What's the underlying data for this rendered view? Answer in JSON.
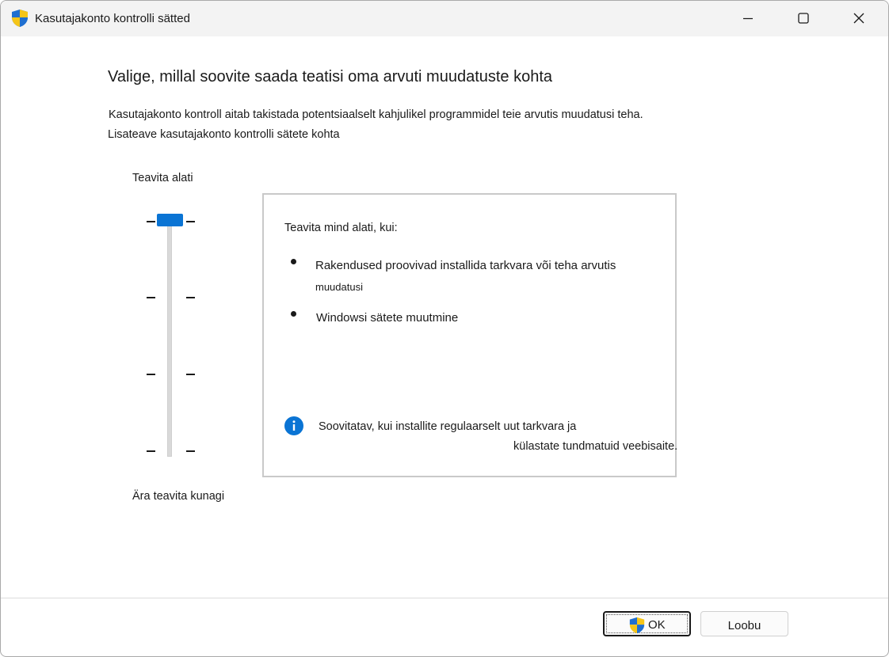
{
  "window": {
    "title": "Kasutajakonto kontrolli sätted",
    "icon": "uac-shield-icon",
    "controls": [
      "minimize-icon",
      "maximize-icon",
      "close-icon"
    ]
  },
  "content": {
    "heading": "Valige, millal soovite saada teatisi oma arvuti muudatuste kohta",
    "description": "Kasutajakonto kontroll aitab takistada potentsiaalselt kahjulikel programmidel teie arvutis muudatusi teha.",
    "learn_more": "Lisateave kasutajakonto kontrolli sätete kohta"
  },
  "slider": {
    "label_top": "Teavita alati",
    "label_bottom": "Ära teavita kunagi",
    "levels": 4,
    "selected_level": 4,
    "accent": "#0a74d4"
  },
  "panel": {
    "title": "Teavita mind alati, kui:",
    "items": [
      {
        "line1": "Rakendused proovivad installida tarkvara või teha arvutis",
        "line2": "muudatusi"
      },
      {
        "line1": "Windowsi sätete muutmine"
      }
    ],
    "recommendation_line1": "Soovitatav, kui installite regulaarselt uut tarkvara ja",
    "recommendation_line2": "külastate tundmatuid veebisaite.",
    "info_icon": "info-icon",
    "info_color": "#0a74d4"
  },
  "buttons": {
    "ok": "OK",
    "cancel": "Loobu"
  }
}
